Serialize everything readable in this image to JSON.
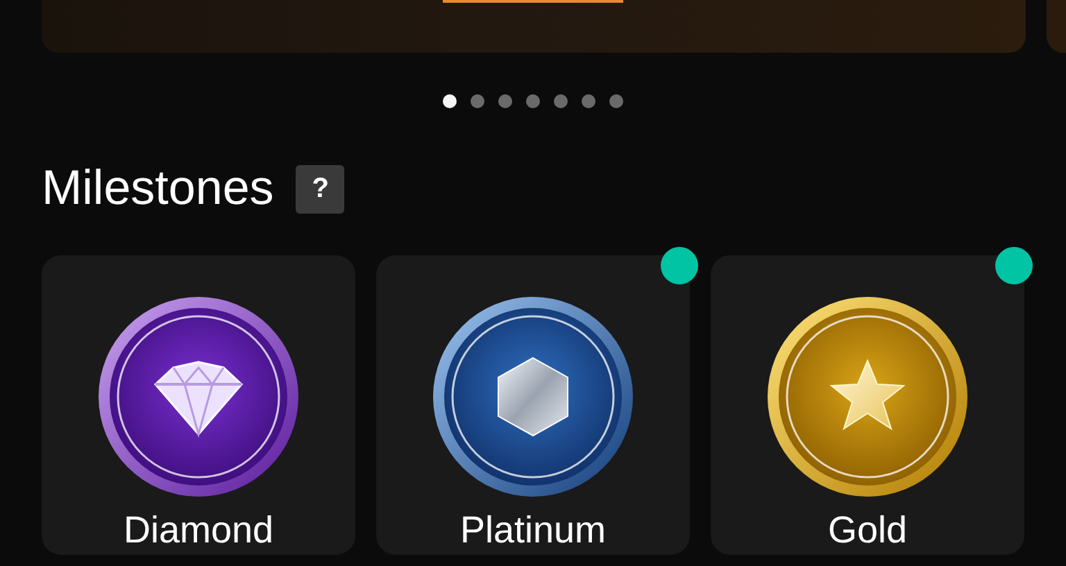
{
  "carousel_dots": [
    {
      "selected": true
    },
    {
      "selected": false
    },
    {
      "selected": false
    },
    {
      "selected": false
    },
    {
      "selected": false
    },
    {
      "selected": false
    },
    {
      "selected": false
    }
  ],
  "section": {
    "title": "Milestones",
    "help": "?"
  },
  "milestones": [
    {
      "name": "Diamond",
      "kind": "diamond",
      "new": false
    },
    {
      "name": "Platinum",
      "kind": "platinum",
      "new": true
    },
    {
      "name": "Gold",
      "kind": "gold",
      "new": true
    }
  ]
}
